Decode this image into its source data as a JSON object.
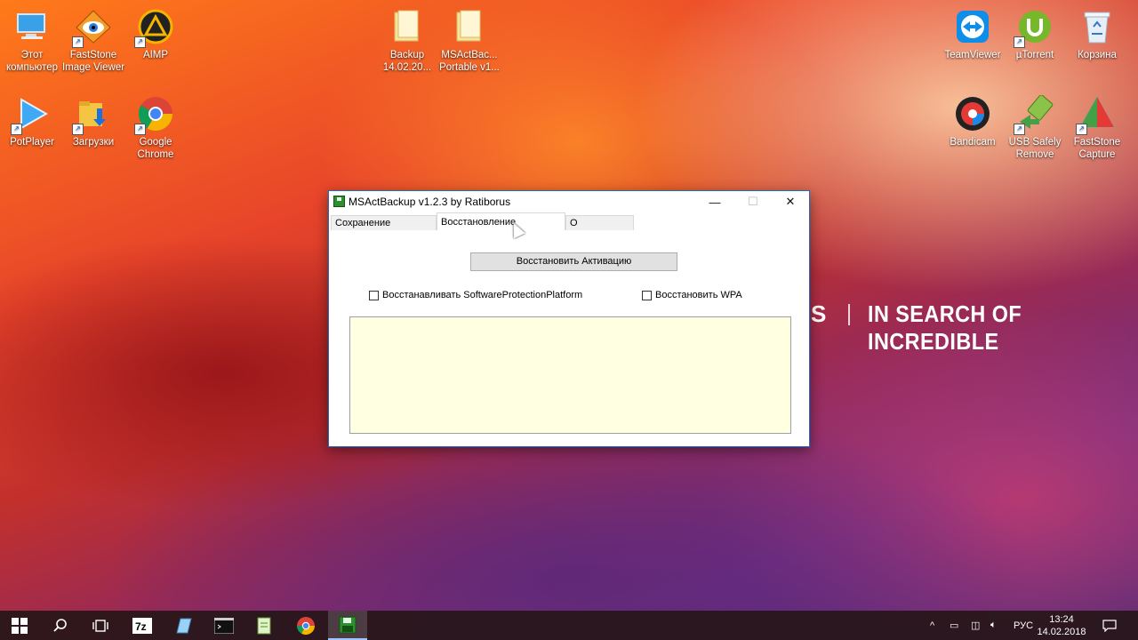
{
  "desktop": {
    "left_icons": [
      {
        "label": "Этот компьютер",
        "icon": "computer-icon"
      },
      {
        "label": "FastStone Image Viewer",
        "icon": "faststone-viewer-icon"
      },
      {
        "label": "AIMP",
        "icon": "aimp-icon"
      },
      {
        "label": "PotPlayer",
        "icon": "potplayer-icon"
      },
      {
        "label": "Загрузки",
        "icon": "downloads-folder-icon"
      },
      {
        "label": "Google Chrome",
        "icon": "chrome-icon"
      }
    ],
    "middle_icons": [
      {
        "label": "Backup 14.02.20...",
        "icon": "folder-icon"
      },
      {
        "label": "MSActBac... Portable v1...",
        "icon": "folder-icon"
      }
    ],
    "right_icons": [
      {
        "label": "TeamViewer",
        "icon": "teamviewer-icon"
      },
      {
        "label": "µTorrent",
        "icon": "utorrent-icon"
      },
      {
        "label": "Корзина",
        "icon": "recycle-bin-icon"
      },
      {
        "label": "Bandicam",
        "icon": "bandicam-icon"
      },
      {
        "label": "USB Safely Remove",
        "icon": "usb-remove-icon"
      },
      {
        "label": "FastStone Capture",
        "icon": "faststone-capture-icon"
      }
    ],
    "wallpaper_text": "IN SEARCH OF INCREDIBLE"
  },
  "window": {
    "title": "MSActBackup v1.2.3 by Ratiborus",
    "controls": {
      "minimize": "—",
      "maximize": "☐",
      "close": "✕"
    },
    "tabs": [
      {
        "label": "Сохранение Активации",
        "active": false
      },
      {
        "label": "Восстановление Активации",
        "active": true
      },
      {
        "label": "О Программе",
        "active": false
      }
    ],
    "restore_button": "Восстановить Активацию",
    "checkbox_spp": {
      "label": "Восстанавливать SoftwareProtectionPlatform",
      "checked": false
    },
    "checkbox_wpa": {
      "label": "Восстановить WPA",
      "checked": false
    },
    "log_text": ""
  },
  "taskbar": {
    "language": "РУС",
    "time": "13:24",
    "date": "14.02.2018"
  },
  "colors": {
    "accent": "#1c6fbf",
    "log_background": "#ffffe1",
    "taskbar": "#261618"
  }
}
